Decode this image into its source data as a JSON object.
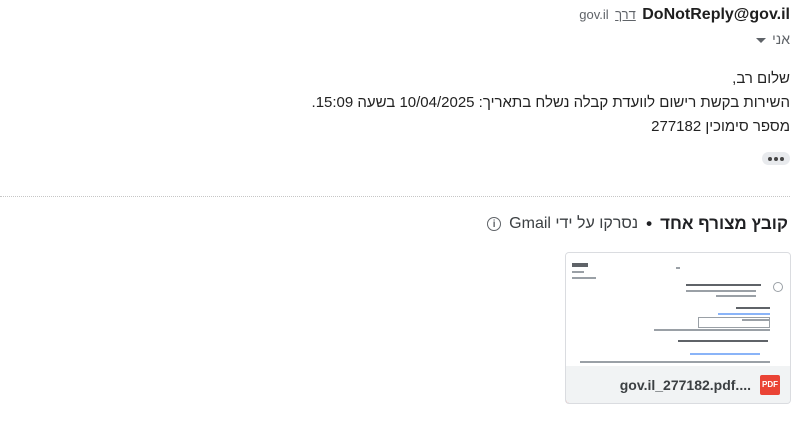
{
  "sender": {
    "address": "DoNotReply@gov.il",
    "via_label": "דרך",
    "via_domain": "gov.il"
  },
  "recipient": {
    "label": "אני"
  },
  "message": {
    "greeting": "שלום רב,",
    "line1": "השירות בקשת רישום לוועדת קבלה נשלח בתאריך: 10/04/2025 בשעה 15:09.",
    "line2": "מספר סימוכין 277182"
  },
  "attachments": {
    "count_label": "קובץ מצורף אחד",
    "separator": "•",
    "scanned_label": "נסרקו על ידי Gmail",
    "items": [
      {
        "file_name": "gov.il_277182.pdf....",
        "type_badge": "PDF"
      }
    ]
  },
  "colors": {
    "pdf_red": "#ea4335",
    "muted_text": "#5f6368",
    "card_bg": "#f1f3f4"
  }
}
